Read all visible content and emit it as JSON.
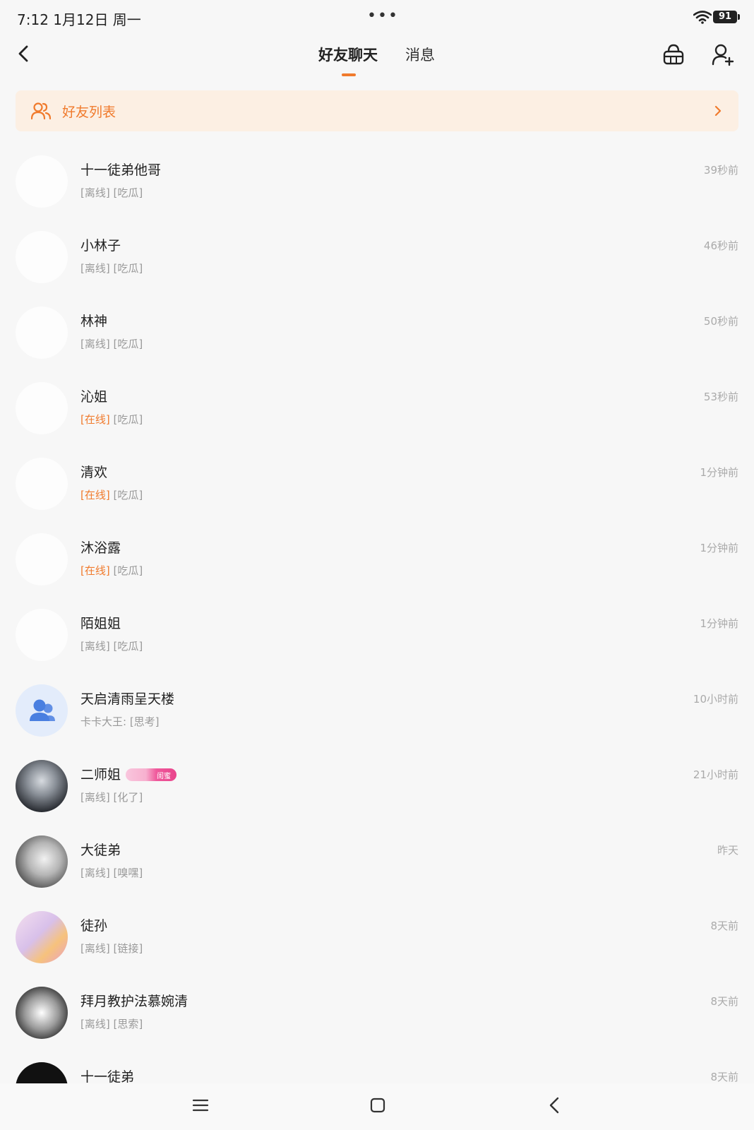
{
  "status_bar": {
    "time": "7:12  1月12日 周一",
    "dots": "•••",
    "battery": "91"
  },
  "nav": {
    "tabs": [
      {
        "label": "好友聊天"
      },
      {
        "label": "消息"
      }
    ]
  },
  "friend_banner": {
    "label": "好友列表"
  },
  "colors": {
    "accent": "#f07a2c",
    "banner_bg": "#fcefe3",
    "online": "#f07a2c",
    "muted": "#999999"
  },
  "chats": [
    {
      "name": "十一徒弟他哥",
      "status": "[离线]",
      "status_online": false,
      "preview": " [吃瓜]",
      "time": "39秒前",
      "avatar": "blank"
    },
    {
      "name": "小林子",
      "status": "[离线]",
      "status_online": false,
      "preview": " [吃瓜]",
      "time": "46秒前",
      "avatar": "blank"
    },
    {
      "name": "林神",
      "status": "[离线]",
      "status_online": false,
      "preview": " [吃瓜]",
      "time": "50秒前",
      "avatar": "blank"
    },
    {
      "name": "沁姐",
      "status": "[在线]",
      "status_online": true,
      "preview": " [吃瓜]",
      "time": "53秒前",
      "avatar": "blank"
    },
    {
      "name": "清欢",
      "status": "[在线]",
      "status_online": true,
      "preview": " [吃瓜]",
      "time": "1分钟前",
      "avatar": "blank"
    },
    {
      "name": "沐浴露",
      "status": "[在线]",
      "status_online": true,
      "preview": " [吃瓜]",
      "time": "1分钟前",
      "avatar": "blank"
    },
    {
      "name": "陌姐姐",
      "status": "[离线]",
      "status_online": false,
      "preview": " [吃瓜]",
      "time": "1分钟前",
      "avatar": "blank"
    },
    {
      "name": "天启清雨呈天楼",
      "status": "",
      "status_online": false,
      "preview": "卡卡大王: [思考]",
      "time": "10小时前",
      "avatar": "group"
    },
    {
      "name": "二师姐",
      "status": "[离线]",
      "status_online": false,
      "preview": " [化了]",
      "time": "21小时前",
      "avatar": "photo-dark",
      "badge": "闺蜜"
    },
    {
      "name": "大徒弟",
      "status": "[离线]",
      "status_online": false,
      "preview": " [嗅嘿]",
      "time": "昨天",
      "avatar": "photo-grey"
    },
    {
      "name": "徒孙",
      "status": "[离线]",
      "status_online": false,
      "preview": " [链接]",
      "time": "8天前",
      "avatar": "photo-pink"
    },
    {
      "name": "拜月教护法慕婉清",
      "status": "[离线]",
      "status_online": false,
      "preview": " [思索]",
      "time": "8天前",
      "avatar": "photo-mono"
    },
    {
      "name": "十一徒弟",
      "status": "",
      "status_online": false,
      "preview": "",
      "time": "8天前",
      "avatar": "photo-black"
    }
  ]
}
